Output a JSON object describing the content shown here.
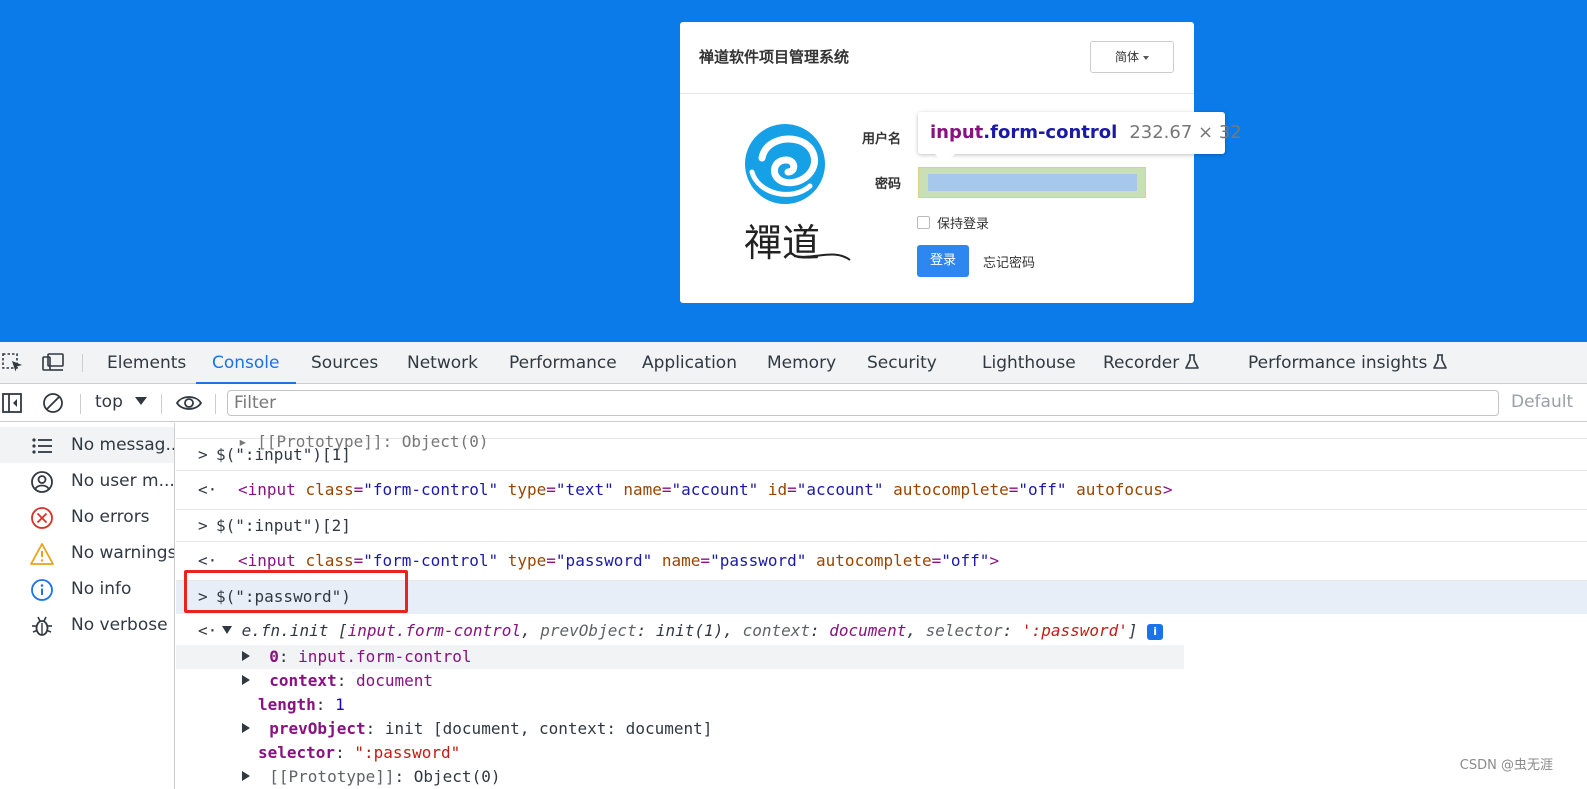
{
  "page": {
    "card_title": "禅道软件项目管理系统",
    "lang_label": "简体",
    "logo_text": "禪道",
    "username_label": "用户名",
    "password_label": "密码",
    "keep_login_label": "保持登录",
    "login_button": "登录",
    "forgot_link": "忘记密码",
    "tooltip": {
      "tag": "input",
      "cls": ".form-control",
      "size": "232.67 × 32"
    }
  },
  "devtools": {
    "tabs": [
      "Elements",
      "Console",
      "Sources",
      "Network",
      "Performance",
      "Application",
      "Memory",
      "Security",
      "Lighthouse",
      "Recorder",
      "Performance insights"
    ],
    "active_tab": "Console",
    "context": "top",
    "filter_placeholder": "Filter",
    "levels_label": "Default",
    "sidebar": [
      {
        "label": "No messag...",
        "icon": "list-icon"
      },
      {
        "label": "No user m...",
        "icon": "user-icon"
      },
      {
        "label": "No errors",
        "icon": "error-icon"
      },
      {
        "label": "No warnings",
        "icon": "warning-icon"
      },
      {
        "label": "No info",
        "icon": "info-icon"
      },
      {
        "label": "No verbose",
        "icon": "bug-icon"
      }
    ],
    "console": {
      "top_partial": "▸ [[Prototype]]: Object(0)",
      "cmd1": "$(\":input\")[1]",
      "out1": {
        "open": "<input",
        "parts": [
          [
            "class",
            "\"form-control\""
          ],
          [
            "type",
            "\"text\""
          ],
          [
            "name",
            "\"account\""
          ],
          [
            "id",
            "\"account\""
          ],
          [
            "autocomplete",
            "\"off\""
          ]
        ],
        "tail": "autofocus>"
      },
      "cmd2": "$(\":input\")[2]",
      "out2": {
        "open": "<input",
        "parts": [
          [
            "class",
            "\"form-control\""
          ],
          [
            "type",
            "\"password\""
          ],
          [
            "name",
            "\"password\""
          ],
          [
            "autocomplete",
            "\"off\""
          ]
        ],
        "tail": ">"
      },
      "cmd3": "$(\":password\")",
      "result_head": "e.fn.init",
      "result_summary": {
        "first": "input.form-control",
        "prev_key": "prevObject",
        "prev_val": "init(1)",
        "ctx_key": "context",
        "ctx_val": "document",
        "sel_key": "selector",
        "sel_val": "':password'"
      },
      "props": [
        {
          "key": "0",
          "value": "input.form-control"
        },
        {
          "key": "context",
          "value": "document"
        },
        {
          "key": "length",
          "value": "1"
        },
        {
          "key": "prevObject",
          "value": "init [document, context: document]"
        },
        {
          "key": "selector",
          "value": "\":password\""
        },
        {
          "key": "[[Prototype]]",
          "value": "Object(0)"
        }
      ]
    }
  },
  "watermark": "CSDN @虫无涯",
  "colors": {
    "page_bg": "#0b7bea",
    "accent": "#1a73e8",
    "highlight_box": "#e8241e",
    "login_btn": "#2e87f0"
  }
}
